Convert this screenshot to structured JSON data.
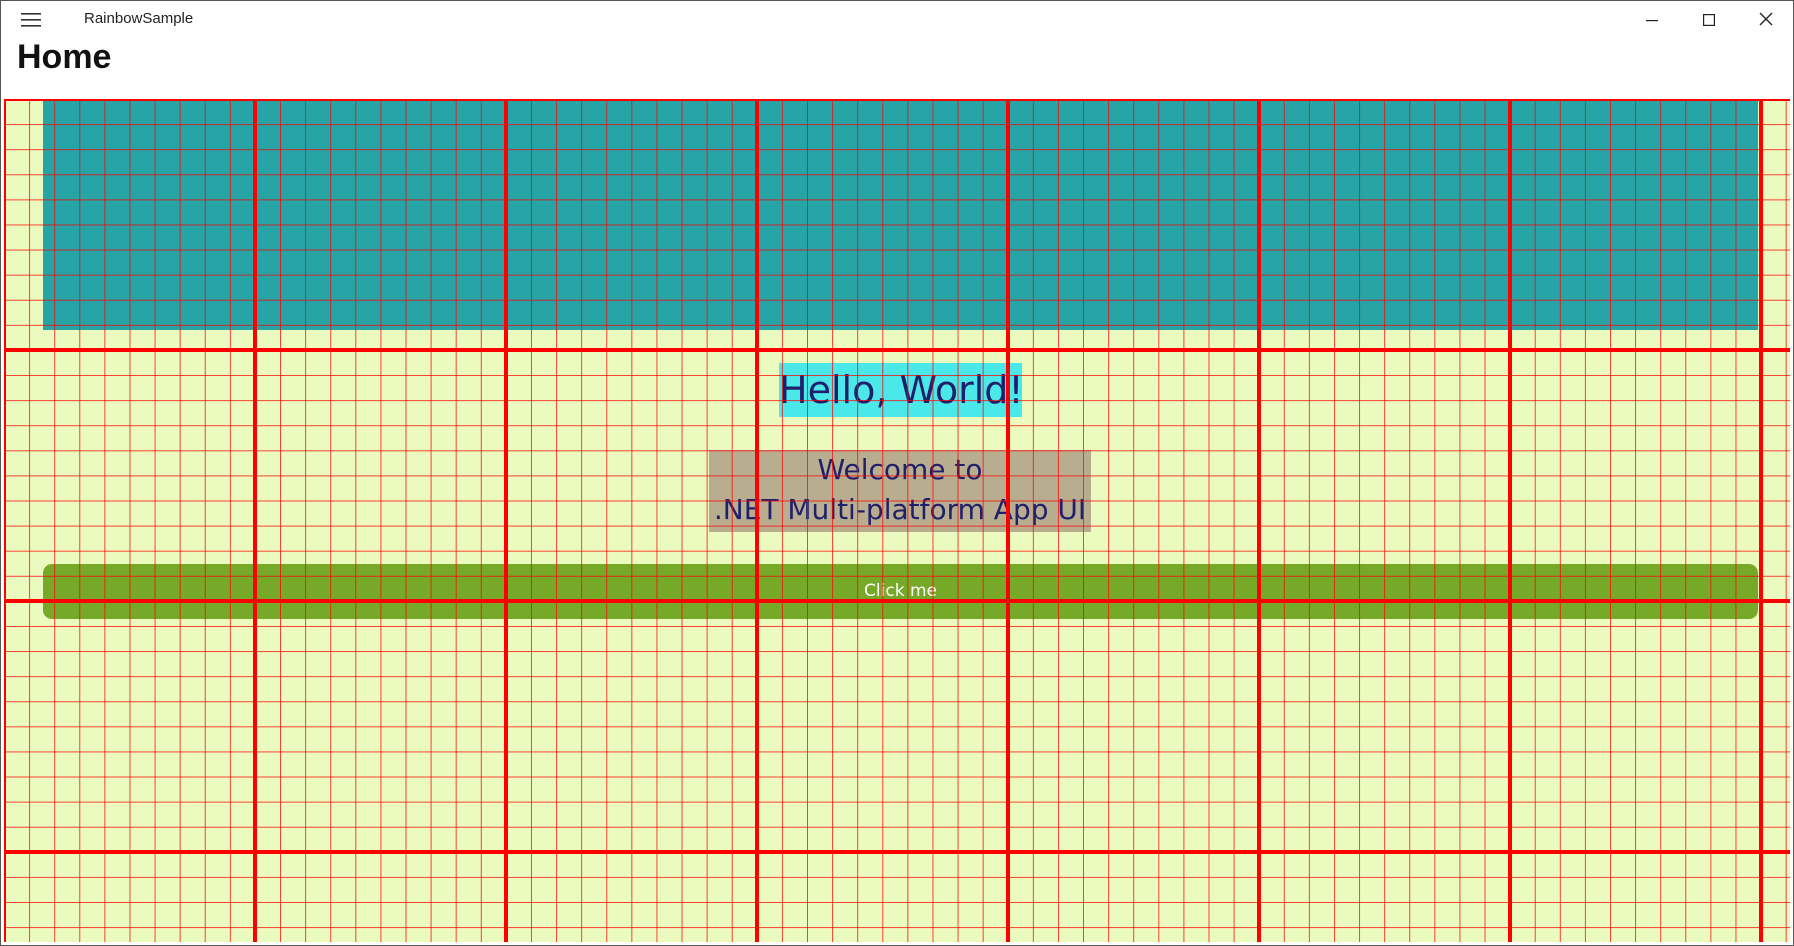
{
  "window": {
    "title": "RainbowSample"
  },
  "header": {
    "page_title": "Home"
  },
  "content": {
    "hello_text": "Hello, World!",
    "welcome_line1": "Welcome to",
    "welcome_line2": ".NET Multi-platform App UI",
    "button_label": "Click me"
  },
  "icons": {
    "menu": "hamburger-menu-icon",
    "minimize": "minimize-icon",
    "maximize": "maximize-icon",
    "close": "close-icon"
  },
  "colors": {
    "background": "#ebfbc0",
    "grid": "#ff0000",
    "banner": "#26a4a6",
    "hello_bg": "#4ae8e8",
    "welcome_bg": "#b9ad90",
    "button_bg": "#77a929",
    "text": "#1f1f6b"
  }
}
